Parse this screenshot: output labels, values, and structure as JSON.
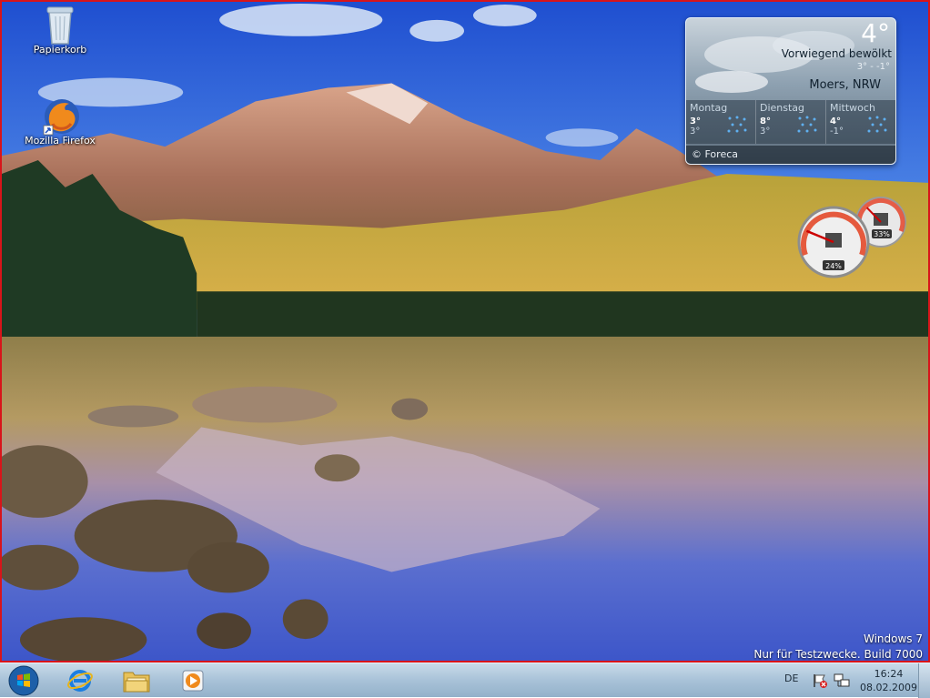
{
  "desktop_icons": [
    {
      "label": "Papierkorb",
      "icon": "recycle-bin-icon"
    },
    {
      "label": "Mozilla Firefox",
      "icon": "firefox-icon"
    }
  ],
  "weather": {
    "temperature": "4°",
    "condition": "Vorwiegend bewölkt",
    "range": "3° - -1°",
    "location": "Moers, NRW",
    "forecast": [
      {
        "day": "Montag",
        "high": "3°",
        "low": "3°"
      },
      {
        "day": "Dienstag",
        "high": "8°",
        "low": "3°"
      },
      {
        "day": "Mittwoch",
        "high": "4°",
        "low": "-1°"
      }
    ],
    "footer": "© Foreca"
  },
  "cpu_meter": {
    "cpu_percent_label": "24%",
    "memory_percent_label": "33%",
    "cpu_percent": 24,
    "memory_percent": 33
  },
  "watermark": {
    "line1": "Windows 7",
    "line2": "Nur für Testzwecke. Build 7000"
  },
  "taskbar": {
    "pinned": [
      "start-orb-icon",
      "internet-explorer-icon",
      "windows-explorer-icon",
      "media-player-icon"
    ],
    "language": "DE",
    "time": "16:24",
    "date": "08.02.2009"
  },
  "colors": {
    "frame_border": "#d8141a",
    "taskbar": "#a8c2d8"
  }
}
